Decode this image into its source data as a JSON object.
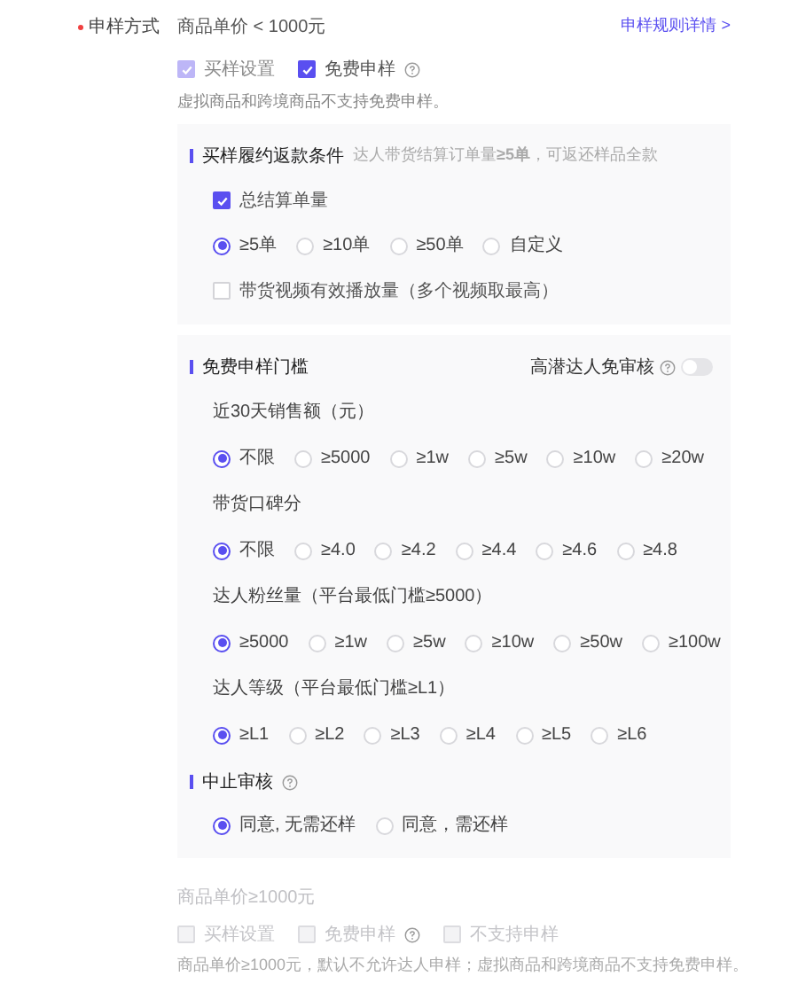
{
  "header": {
    "required": true,
    "label": "申样方式",
    "price_condition": "商品单价 < 1000元",
    "link": "申样规则详情 >"
  },
  "options": [
    {
      "label": "买样设置",
      "checked": true,
      "disabled": true,
      "help": false
    },
    {
      "label": "免费申样",
      "checked": true,
      "disabled": false,
      "help": true
    }
  ],
  "note": "虚拟商品和跨境商品不支持免费申样。",
  "panels": [
    {
      "sections": [
        {
          "title": "买样履约返款条件",
          "hint": "达人带货结算订单量**≥5单**，可返还样品全款",
          "help": false,
          "items": [
            {
              "kind": "checkbox",
              "label": "总结算单量",
              "checked": true
            },
            {
              "kind": "radios",
              "options": [
                {
                  "label": "≥5单",
                  "selected": true
                },
                {
                  "label": "≥10单",
                  "selected": false
                },
                {
                  "label": "≥50单",
                  "selected": false
                },
                {
                  "label": "自定义",
                  "selected": false
                }
              ]
            },
            {
              "kind": "checkbox",
              "label": "带货视频有效播放量（多个视频取最高）",
              "checked": false
            }
          ]
        }
      ]
    },
    {
      "sections": [
        {
          "title": "免费申样门槛",
          "help": false,
          "toggle": {
            "label": "高潜达人免审核",
            "on": false
          },
          "items": [
            {
              "kind": "label",
              "label": "近30天销售额（元）"
            },
            {
              "kind": "radios",
              "options": [
                {
                  "label": "不限",
                  "selected": true
                },
                {
                  "label": "≥5000",
                  "selected": false
                },
                {
                  "label": "≥1w",
                  "selected": false
                },
                {
                  "label": "≥5w",
                  "selected": false
                },
                {
                  "label": "≥10w",
                  "selected": false
                },
                {
                  "label": "≥20w",
                  "selected": false
                }
              ]
            },
            {
              "kind": "label",
              "label": "带货口碑分"
            },
            {
              "kind": "radios",
              "options": [
                {
                  "label": "不限",
                  "selected": true
                },
                {
                  "label": "≥4.0",
                  "selected": false
                },
                {
                  "label": "≥4.2",
                  "selected": false
                },
                {
                  "label": "≥4.4",
                  "selected": false
                },
                {
                  "label": "≥4.6",
                  "selected": false
                },
                {
                  "label": "≥4.8",
                  "selected": false
                }
              ]
            },
            {
              "kind": "label",
              "label": "达人粉丝量（平台最低门槛≥5000）"
            },
            {
              "kind": "radios",
              "options": [
                {
                  "label": "≥5000",
                  "selected": true
                },
                {
                  "label": "≥1w",
                  "selected": false
                },
                {
                  "label": "≥5w",
                  "selected": false
                },
                {
                  "label": "≥10w",
                  "selected": false
                },
                {
                  "label": "≥50w",
                  "selected": false
                },
                {
                  "label": "≥100w",
                  "selected": false
                }
              ]
            },
            {
              "kind": "label",
              "label": "达人等级（平台最低门槛≥L1）"
            },
            {
              "kind": "radios",
              "options": [
                {
                  "label": "≥L1",
                  "selected": true
                },
                {
                  "label": "≥L2",
                  "selected": false
                },
                {
                  "label": "≥L3",
                  "selected": false
                },
                {
                  "label": "≥L4",
                  "selected": false
                },
                {
                  "label": "≥L5",
                  "selected": false
                },
                {
                  "label": "≥L6",
                  "selected": false
                }
              ]
            }
          ]
        },
        {
          "title": "中止审核",
          "help": true,
          "items": [
            {
              "kind": "radios",
              "options": [
                {
                  "label": "同意, 无需还样",
                  "selected": true
                },
                {
                  "label": "同意，需还样",
                  "selected": false
                }
              ]
            }
          ]
        }
      ]
    }
  ],
  "high_price": {
    "price_condition": "商品单价≥1000元",
    "options": [
      {
        "label": "买样设置",
        "checked": false,
        "disabled": true,
        "help": false
      },
      {
        "label": "免费申样",
        "checked": false,
        "disabled": true,
        "help": true
      },
      {
        "label": "不支持申样",
        "checked": false,
        "disabled": true,
        "help": false
      }
    ],
    "note": "商品单价≥1000元，默认不允许达人申样；虚拟商品和跨境商品不支持免费申样。"
  }
}
